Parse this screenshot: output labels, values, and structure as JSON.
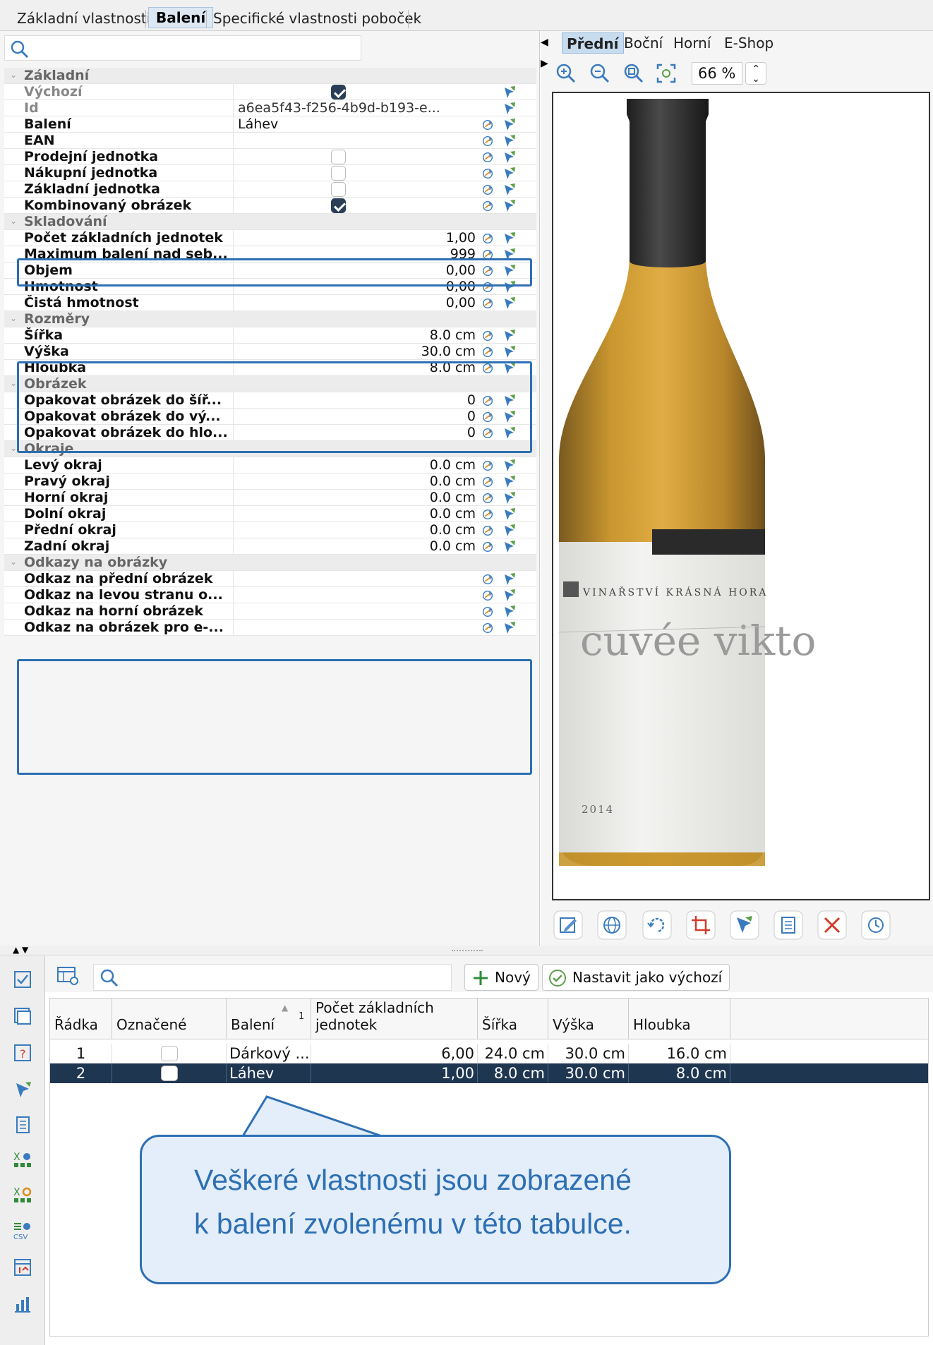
{
  "top_tabs": [
    "Základní vlastnosti",
    "Balení",
    "Specifické vlastnosti poboček"
  ],
  "top_tab_active": "Balení",
  "properties": {
    "groups": {
      "zakladni": "Základní",
      "skladovani": "Skladování",
      "rozmery": "Rozměry",
      "obrazek": "Obrázek",
      "okraje": "Okraje",
      "odkazy": "Odkazy na obrázky"
    },
    "rows": {
      "vychozi": {
        "label": "Výchozí",
        "checked": true
      },
      "id": {
        "label": "Id",
        "value": "a6ea5f43-f256-4b9d-b193-e..."
      },
      "baleni": {
        "label": "Balení",
        "value": "Láhev"
      },
      "ean": {
        "label": "EAN",
        "value": ""
      },
      "prodejni": {
        "label": "Prodejní jednotka",
        "checked": false
      },
      "nakupni": {
        "label": "Nákupní jednotka",
        "checked": false
      },
      "zakladni": {
        "label": "Základní jednotka",
        "checked": false
      },
      "kombinovany": {
        "label": "Kombinovaný obrázek",
        "checked": true
      },
      "pocet": {
        "label": "Počet základních jednotek",
        "value": "1,00"
      },
      "maximum": {
        "label": "Maximum balení nad seb...",
        "value": "999"
      },
      "objem": {
        "label": "Objem",
        "value": "0,00"
      },
      "hmotnost": {
        "label": "Hmotnost",
        "value": "0,00"
      },
      "cista": {
        "label": "Čistá hmotnost",
        "value": "0,00"
      },
      "sirka": {
        "label": "Šířka",
        "value": "8.0 cm"
      },
      "vyska": {
        "label": "Výška",
        "value": "30.0 cm"
      },
      "hloubka": {
        "label": "Hloubka",
        "value": "8.0 cm"
      },
      "op_sir": {
        "label": "Opakovat obrázek do šíř...",
        "value": "0"
      },
      "op_vys": {
        "label": "Opakovat obrázek do vý...",
        "value": "0"
      },
      "op_hlo": {
        "label": "Opakovat obrázek do hlo...",
        "value": "0"
      },
      "levy": {
        "label": "Levý okraj",
        "value": "0.0 cm"
      },
      "pravy": {
        "label": "Pravý okraj",
        "value": "0.0 cm"
      },
      "horni": {
        "label": "Horní okraj",
        "value": "0.0 cm"
      },
      "dolni": {
        "label": "Dolní okraj",
        "value": "0.0 cm"
      },
      "predni": {
        "label": "Přední okraj",
        "value": "0.0 cm"
      },
      "zadni": {
        "label": "Zadní okraj",
        "value": "0.0 cm"
      },
      "odkaz_predni": {
        "label": "Odkaz na přední obrázek",
        "value": ""
      },
      "odkaz_levy": {
        "label": "Odkaz na levou stranu o...",
        "value": ""
      },
      "odkaz_horni": {
        "label": "Odkaz na horní obrázek",
        "value": ""
      },
      "odkaz_eshop": {
        "label": "Odkaz na obrázek pro e-...",
        "value": ""
      }
    }
  },
  "view_tabs": [
    "Přední",
    "Boční",
    "Horní",
    "E-Shop"
  ],
  "view_tab_active": "Přední",
  "zoom": "66 %",
  "bottle": {
    "winery": "VINAŘSTVÍ KRÁSNÁ HORA",
    "name": "cuvée vikto",
    "year": "2014"
  },
  "toolbar": {
    "new_label": "Nový",
    "default_label": "Nastavit jako výchozí"
  },
  "grid": {
    "columns": [
      "Řádka",
      "Označené",
      "Balení",
      "Počet základních jednotek",
      "Šířka",
      "Výška",
      "Hloubka"
    ],
    "sort_index": "1",
    "rows": [
      {
        "radka": "1",
        "oznacene": false,
        "baleni": "Dárkový ...",
        "pocet": "6,00",
        "sirka": "24.0 cm",
        "vyska": "30.0 cm",
        "hloubka": "16.0 cm"
      },
      {
        "radka": "2",
        "oznacene": false,
        "baleni": "Láhev",
        "pocet": "1,00",
        "sirka": "8.0 cm",
        "vyska": "30.0 cm",
        "hloubka": "8.0 cm"
      }
    ],
    "selected_row": "2"
  },
  "callout": {
    "line1": "Veškeré vlastnosti jsou zobrazené",
    "line2": "k balení zvolenému v této tabulce."
  },
  "colors": {
    "highlight": "#2d6fb3",
    "selected_row": "#1f3651",
    "callout_fill": "#e3eefa"
  }
}
